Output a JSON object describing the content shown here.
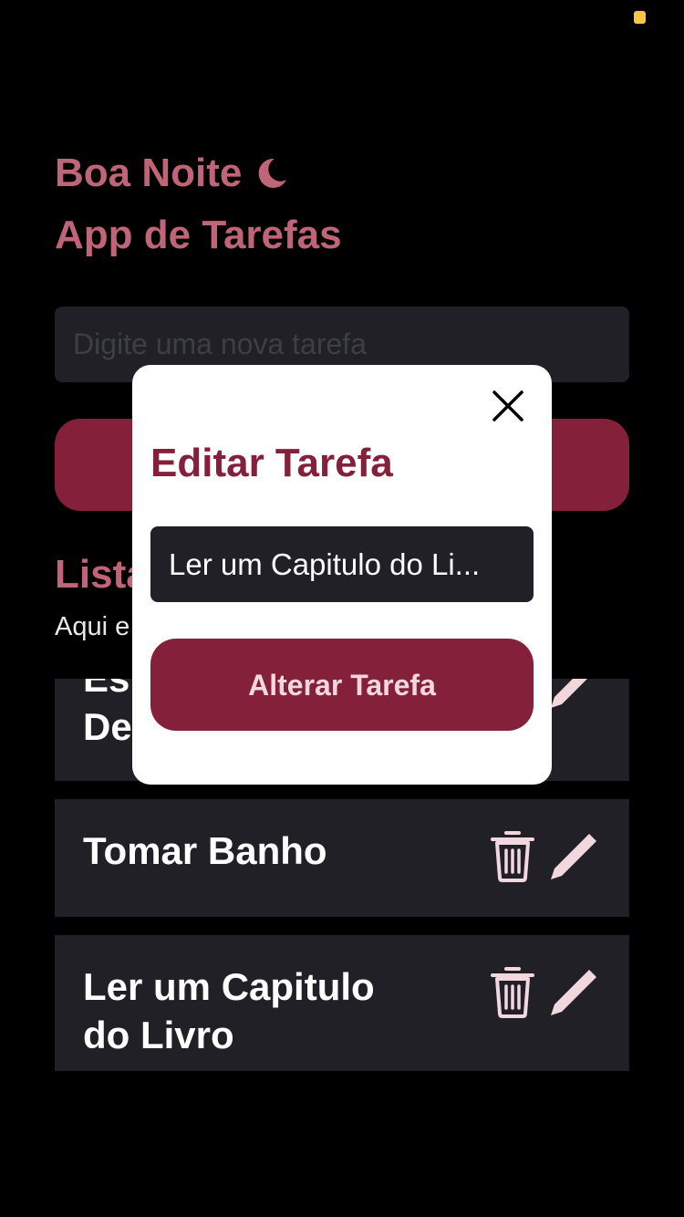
{
  "header": {
    "greeting": "Boa Noite",
    "greeting_icon": "moon-icon",
    "app_title": "App de Tarefas"
  },
  "new_task": {
    "placeholder": "Digite uma nova tarefa"
  },
  "list": {
    "title": "Lista",
    "subtitle": "Aqui e"
  },
  "tasks": [
    {
      "line1": "Es",
      "line2": "De"
    },
    {
      "text": "Tomar Banho"
    },
    {
      "text": "Ler um Capitulo do Livro"
    }
  ],
  "modal": {
    "title": "Editar Tarefa",
    "input_value": "Ler um Capitulo do Li...",
    "confirm_label": "Alterar Tarefa",
    "close_icon": "close-icon"
  },
  "colors": {
    "background": "#000000",
    "accent_text": "#c06577",
    "primary": "#85203b",
    "card": "#202026",
    "icon": "#f3d7df",
    "status_dot": "#f8c642"
  }
}
